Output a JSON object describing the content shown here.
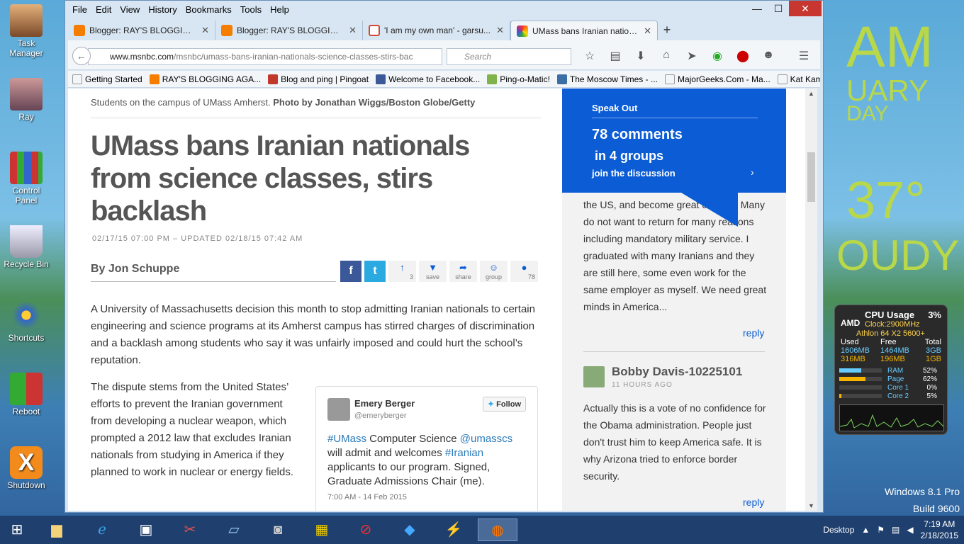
{
  "desktop": {
    "icons": [
      {
        "label": "Task Manager"
      },
      {
        "label": "Ray"
      },
      {
        "label": "Control Panel"
      },
      {
        "label": "Recycle Bin"
      },
      {
        "label": "Shortcuts"
      },
      {
        "label": "Reboot"
      },
      {
        "label": "Shutdown"
      }
    ],
    "wallpaper": {
      "am": "AM",
      "month": "UARY",
      "day": "DAY",
      "temp": "37°",
      "weather": "OUDY"
    },
    "windows_version": "Windows 8.1 Pro",
    "build": "Build 9600"
  },
  "browser": {
    "menu": [
      "File",
      "Edit",
      "View",
      "History",
      "Bookmarks",
      "Tools",
      "Help"
    ],
    "window_buttons": {
      "minimize": "—",
      "maximize": "☐",
      "close": "✕"
    },
    "tabs": [
      {
        "title": "Blogger: RAY'S BLOGGING ...",
        "fav_color": "#f57d00"
      },
      {
        "title": "Blogger: RAY'S BLOGGING ...",
        "fav_color": "#f57d00"
      },
      {
        "title": "'I am my own man' - garsu...",
        "fav_color": "#d14836"
      },
      {
        "title": "UMass bans Iranian nation...",
        "fav_color": "#ffffff"
      }
    ],
    "new_tab": "+",
    "url_domain": "www.msnbc.com",
    "url_path": "/msnbc/umass-bans-iranian-nationals-science-classes-stirs-bac",
    "search_placeholder": "Search",
    "bookmarks": [
      {
        "label": "Getting Started",
        "color": "#ffffff"
      },
      {
        "label": "RAY'S BLOGGING AGA...",
        "color": "#f57d00"
      },
      {
        "label": "Blog and ping | Pingoat",
        "color": "#c0392b"
      },
      {
        "label": "Welcome to Facebook...",
        "color": "#3b5998"
      },
      {
        "label": "Ping-o-Matic!",
        "color": "#7fb24a"
      },
      {
        "label": "The Moscow Times - ...",
        "color": "#3a6ea5"
      },
      {
        "label": "MajorGeeks.Com - Ma...",
        "color": "#ffffff"
      },
      {
        "label": "Kat Kam",
        "color": "#ffffff"
      }
    ]
  },
  "article": {
    "caption_text": "Students on the campus of UMass Amherst.",
    "caption_credit": "Photo by Jonathan Wiggs/Boston Globe/Getty",
    "headline": "UMass bans Iranian nationals from science classes, stirs backlash",
    "dateline": "02/17/15 07:00 PM – UPDATED 02/18/15 07:42 AM",
    "byline": "By Jon Schuppe",
    "share": {
      "facebook": "f",
      "twitter": "t",
      "up_count": "3",
      "save": "save",
      "share": "share",
      "group": "group",
      "comments": "78"
    },
    "para1": "A University of Massachusetts decision this month to stop admitting Iranian nationals to certain engineering and science programs at its Amherst campus has stirred charges of discrimination and a backlash among students who say it was unfairly imposed and could hurt the school’s reputation.",
    "para2": "The dispute stems from the United States’ efforts to prevent the Iranian government from developing a nuclear weapon, which prompted a 2012 law that excludes Iranian nationals from studying in America if they planned to work in nuclear or energy fields.",
    "tweet": {
      "name": "Emery Berger",
      "handle": "@emeryberger",
      "follow": "Follow",
      "tag1": "#UMass",
      "t1": " Computer Science ",
      "tag2": "@umasscs",
      "t2": " will admit and welcomes ",
      "tag3": "#Iranian",
      "t3": " applicants to our program. Signed, Graduate Admissions Chair (me).",
      "time": "7:00 AM - 14 Feb 2015"
    }
  },
  "sidebar": {
    "speak_out": "Speak Out",
    "comments": "78 comments",
    "groups": "in 4 groups",
    "join": "join the discussion",
    "comment1": "the US, and become great citizens. Many do not want to return for many reasons including mandatory military service. I graduated with many Iranians and they are still here, some even work for the same employer as myself. We need great minds in America...",
    "reply": "reply",
    "comment2_author": "Bobby Davis-10225101",
    "comment2_time": "11 HOURS AGO",
    "comment2": "Actually this is a vote of no confidence for the Obama administration. People just don't trust him to keep America safe. It is why Arizona tried to enforce border security."
  },
  "gadget": {
    "title": "CPU Usage",
    "pct": "3%",
    "brand": "AMD",
    "clock": "Clock:2900MHz",
    "model": "Athlon 64 X2 5600+",
    "headers": [
      "Used",
      "Free",
      "Total"
    ],
    "rows": [
      [
        "1606MB",
        "1464MB",
        "3GB"
      ],
      [
        "316MB",
        "196MB",
        "1GB"
      ]
    ],
    "bars": [
      {
        "label": "RAM",
        "value": "52%",
        "fraction": 0.52,
        "color": "#6cf"
      },
      {
        "label": "Page",
        "value": "62%",
        "fraction": 0.62,
        "color": "#f5b400"
      },
      {
        "label": "Core 1",
        "value": "0%",
        "fraction": 0.0,
        "color": "#f5b400"
      },
      {
        "label": "Core 2",
        "value": "5%",
        "fraction": 0.05,
        "color": "#f5b400"
      }
    ]
  },
  "taskbar": {
    "desktop_label": "Desktop",
    "time": "7:19 AM",
    "date": "2/18/2015"
  }
}
